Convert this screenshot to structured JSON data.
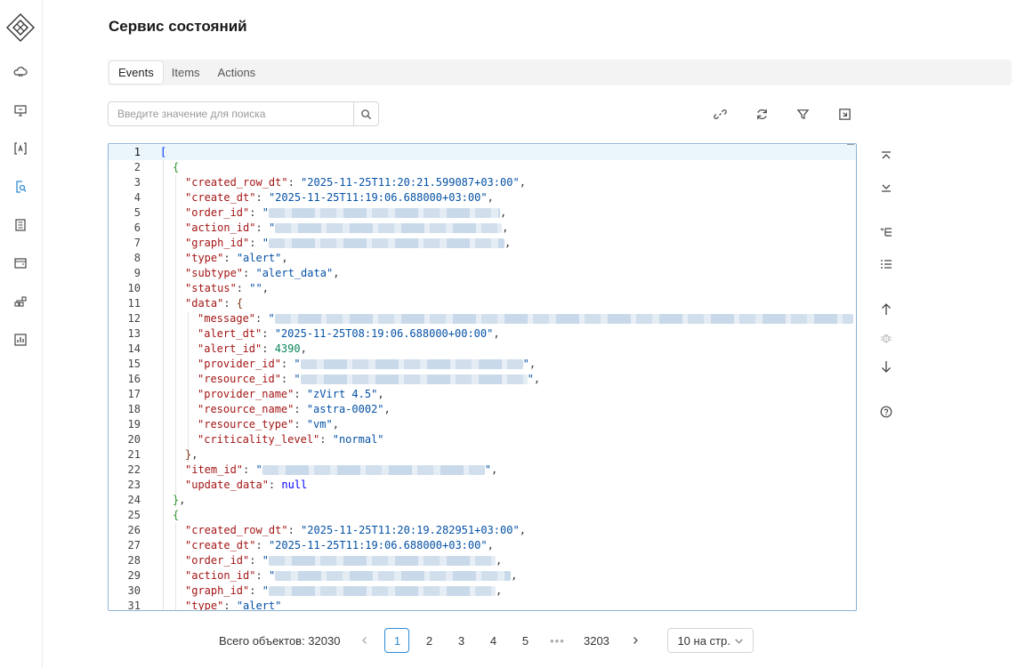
{
  "app": {
    "title": "Сервис состояний"
  },
  "sidebar": {
    "items": [
      {
        "icon": "cloud-icon"
      },
      {
        "icon": "monitor-icon"
      },
      {
        "icon": "code-brackets-icon"
      },
      {
        "icon": "search-document-icon"
      },
      {
        "icon": "list-document-icon"
      },
      {
        "icon": "wallet-icon"
      },
      {
        "icon": "network-icon"
      },
      {
        "icon": "report-icon"
      }
    ]
  },
  "tabs": [
    {
      "label": "Events",
      "active": true
    },
    {
      "label": "Items",
      "active": false
    },
    {
      "label": "Actions",
      "active": false
    }
  ],
  "search": {
    "placeholder": "Введите значение для поиска",
    "value": ""
  },
  "toolbar": {
    "icons": [
      "link-icon",
      "refresh-icon",
      "filter-icon",
      "expand-icon"
    ]
  },
  "editor": {
    "current_line": 1,
    "lines": [
      {
        "n": "1",
        "ind": 0,
        "t": [
          [
            "br1",
            "["
          ]
        ]
      },
      {
        "n": "2",
        "ind": 1,
        "t": [
          [
            "br2",
            "{"
          ]
        ]
      },
      {
        "n": "3",
        "ind": 2,
        "t": [
          [
            "k",
            "\"created_row_dt\""
          ],
          [
            "p",
            ": "
          ],
          [
            "s",
            "\"2025-11-25T11:20:21.599087+03:00\""
          ],
          [
            "p",
            ","
          ]
        ]
      },
      {
        "n": "4",
        "ind": 2,
        "t": [
          [
            "k",
            "\"create_dt\""
          ],
          [
            "p",
            ": "
          ],
          [
            "s",
            "\"2025-11-25T11:19:06.688000+03:00\""
          ],
          [
            "p",
            ","
          ]
        ]
      },
      {
        "n": "5",
        "ind": 2,
        "t": [
          [
            "k",
            "\"order_id\""
          ],
          [
            "p",
            ": "
          ],
          [
            "s",
            "\""
          ],
          [
            "blur",
            "260"
          ],
          [
            "p",
            ","
          ]
        ]
      },
      {
        "n": "6",
        "ind": 2,
        "t": [
          [
            "k",
            "\"action_id\""
          ],
          [
            "p",
            ": "
          ],
          [
            "s",
            "\""
          ],
          [
            "blur",
            "255"
          ],
          [
            "p",
            ","
          ]
        ]
      },
      {
        "n": "7",
        "ind": 2,
        "t": [
          [
            "k",
            "\"graph_id\""
          ],
          [
            "p",
            ": "
          ],
          [
            "s",
            "\""
          ],
          [
            "blur",
            "265"
          ],
          [
            "p",
            ","
          ]
        ]
      },
      {
        "n": "8",
        "ind": 2,
        "t": [
          [
            "k",
            "\"type\""
          ],
          [
            "p",
            ": "
          ],
          [
            "s",
            "\"alert\""
          ],
          [
            "p",
            ","
          ]
        ]
      },
      {
        "n": "9",
        "ind": 2,
        "t": [
          [
            "k",
            "\"subtype\""
          ],
          [
            "p",
            ": "
          ],
          [
            "s",
            "\"alert_data\""
          ],
          [
            "p",
            ","
          ]
        ]
      },
      {
        "n": "10",
        "ind": 2,
        "t": [
          [
            "k",
            "\"status\""
          ],
          [
            "p",
            ": "
          ],
          [
            "s",
            "\"\""
          ],
          [
            "p",
            ","
          ]
        ]
      },
      {
        "n": "11",
        "ind": 2,
        "t": [
          [
            "k",
            "\"data\""
          ],
          [
            "p",
            ": "
          ],
          [
            "br3",
            "{"
          ]
        ]
      },
      {
        "n": "12",
        "ind": 3,
        "t": [
          [
            "k",
            "\"message\""
          ],
          [
            "p",
            ": "
          ],
          [
            "s",
            "\""
          ],
          [
            "blur",
            "650"
          ]
        ]
      },
      {
        "n": "13",
        "ind": 3,
        "t": [
          [
            "k",
            "\"alert_dt\""
          ],
          [
            "p",
            ": "
          ],
          [
            "s",
            "\"2025-11-25T08:19:06.688000+00:00\""
          ],
          [
            "p",
            ","
          ]
        ]
      },
      {
        "n": "14",
        "ind": 3,
        "t": [
          [
            "k",
            "\"alert_id\""
          ],
          [
            "p",
            ": "
          ],
          [
            "n",
            "4390"
          ],
          [
            "p",
            ","
          ]
        ]
      },
      {
        "n": "15",
        "ind": 3,
        "t": [
          [
            "k",
            "\"provider_id\""
          ],
          [
            "p",
            ": "
          ],
          [
            "s",
            "\""
          ],
          [
            "blur",
            "250"
          ],
          [
            "s",
            "\""
          ],
          [
            "p",
            ","
          ]
        ]
      },
      {
        "n": "16",
        "ind": 3,
        "t": [
          [
            "k",
            "\"resource_id\""
          ],
          [
            "p",
            ": "
          ],
          [
            "s",
            "\""
          ],
          [
            "blur",
            "255"
          ],
          [
            "s",
            "\""
          ],
          [
            "p",
            ","
          ]
        ]
      },
      {
        "n": "17",
        "ind": 3,
        "t": [
          [
            "k",
            "\"provider_name\""
          ],
          [
            "p",
            ": "
          ],
          [
            "s",
            "\"zVirt 4.5\""
          ],
          [
            "p",
            ","
          ]
        ]
      },
      {
        "n": "18",
        "ind": 3,
        "t": [
          [
            "k",
            "\"resource_name\""
          ],
          [
            "p",
            ": "
          ],
          [
            "s",
            "\"astra-0002\""
          ],
          [
            "p",
            ","
          ]
        ]
      },
      {
        "n": "19",
        "ind": 3,
        "t": [
          [
            "k",
            "\"resource_type\""
          ],
          [
            "p",
            ": "
          ],
          [
            "s",
            "\"vm\""
          ],
          [
            "p",
            ","
          ]
        ]
      },
      {
        "n": "20",
        "ind": 3,
        "t": [
          [
            "k",
            "\"criticality_level\""
          ],
          [
            "p",
            ": "
          ],
          [
            "s",
            "\"normal\""
          ]
        ]
      },
      {
        "n": "21",
        "ind": 2,
        "t": [
          [
            "br3",
            "}"
          ],
          [
            "p",
            ","
          ]
        ]
      },
      {
        "n": "22",
        "ind": 2,
        "t": [
          [
            "k",
            "\"item_id\""
          ],
          [
            "p",
            ": "
          ],
          [
            "s",
            "\""
          ],
          [
            "blur",
            "250"
          ],
          [
            "s",
            "\""
          ],
          [
            "p",
            ","
          ]
        ]
      },
      {
        "n": "23",
        "ind": 2,
        "t": [
          [
            "k",
            "\"update_data\""
          ],
          [
            "p",
            ": "
          ],
          [
            "nl",
            "null"
          ]
        ]
      },
      {
        "n": "24",
        "ind": 1,
        "t": [
          [
            "br2",
            "}"
          ],
          [
            "p",
            ","
          ]
        ]
      },
      {
        "n": "25",
        "ind": 1,
        "t": [
          [
            "br2",
            "{"
          ]
        ]
      },
      {
        "n": "26",
        "ind": 2,
        "t": [
          [
            "k",
            "\"created_row_dt\""
          ],
          [
            "p",
            ": "
          ],
          [
            "s",
            "\"2025-11-25T11:20:19.282951+03:00\""
          ],
          [
            "p",
            ","
          ]
        ]
      },
      {
        "n": "27",
        "ind": 2,
        "t": [
          [
            "k",
            "\"create_dt\""
          ],
          [
            "p",
            ": "
          ],
          [
            "s",
            "\"2025-11-25T11:19:06.688000+03:00\""
          ],
          [
            "p",
            ","
          ]
        ]
      },
      {
        "n": "28",
        "ind": 2,
        "t": [
          [
            "k",
            "\"order_id\""
          ],
          [
            "p",
            ": "
          ],
          [
            "s",
            "\""
          ],
          [
            "blur",
            "255"
          ],
          [
            "p",
            ","
          ]
        ]
      },
      {
        "n": "29",
        "ind": 2,
        "t": [
          [
            "k",
            "\"action_id\""
          ],
          [
            "p",
            ": "
          ],
          [
            "s",
            "\""
          ],
          [
            "blur",
            "265"
          ],
          [
            "p",
            ","
          ]
        ]
      },
      {
        "n": "30",
        "ind": 2,
        "t": [
          [
            "k",
            "\"graph_id\""
          ],
          [
            "p",
            ": "
          ],
          [
            "s",
            "\""
          ],
          [
            "blur",
            "255"
          ],
          [
            "p",
            ","
          ]
        ]
      },
      {
        "n": "31",
        "ind": 2,
        "t": [
          [
            "k",
            "\"type\""
          ],
          [
            "p",
            ": "
          ],
          [
            "s",
            "\"alert\""
          ]
        ]
      }
    ]
  },
  "right_tools": [
    "scroll-top-icon",
    "scroll-bottom-icon",
    "fold-icon",
    "unfold-icon",
    "arrow-up-icon",
    "bug-icon",
    "arrow-down-icon",
    "help-icon"
  ],
  "pagination": {
    "total_label": "Всего объектов: 32030",
    "pages": [
      "1",
      "2",
      "3",
      "4",
      "5"
    ],
    "dots": "•••",
    "last_page": "3203",
    "active_page": "1",
    "page_size": "10 на стр."
  }
}
